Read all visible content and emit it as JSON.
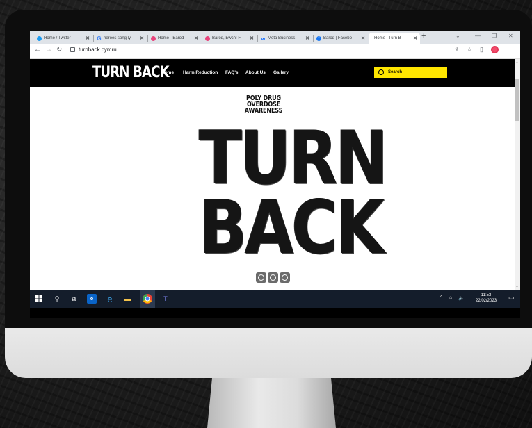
{
  "browser": {
    "tabs": [
      {
        "label": "Home / Twitter",
        "icon": "twitter-icon",
        "color": "#1d9bf0"
      },
      {
        "label": "heroes song ly",
        "icon": "google-icon",
        "color": "#4285f4"
      },
      {
        "label": "Home - Barod",
        "icon": "barod-icon",
        "color": "#e8437b"
      },
      {
        "label": "Barod, Ewch! F",
        "icon": "barod-icon",
        "color": "#e8437b"
      },
      {
        "label": "Meta Business",
        "icon": "meta-icon",
        "color": "#0866ff"
      },
      {
        "label": "Barod | Facebo",
        "icon": "facebook-icon",
        "color": "#1877f2"
      },
      {
        "label": "Home | Turn B",
        "icon": "none",
        "color": "#ffffff"
      }
    ],
    "new_tab": "+",
    "url": "turnback.cymru"
  },
  "site": {
    "logo": "TURN BACK",
    "nav": [
      "Home",
      "Harm Reduction",
      "FAQ's",
      "About Us",
      "Gallery"
    ],
    "search_placeholder": "Search",
    "accent": "#ffe600"
  },
  "hero": {
    "tagline_lines": [
      "POLY DRUG",
      "OVERDOSE",
      "AWARENESS"
    ],
    "word1": "TURN",
    "word2": "BACK"
  },
  "taskbar": {
    "time": "11:53",
    "date": "22/02/2023"
  }
}
